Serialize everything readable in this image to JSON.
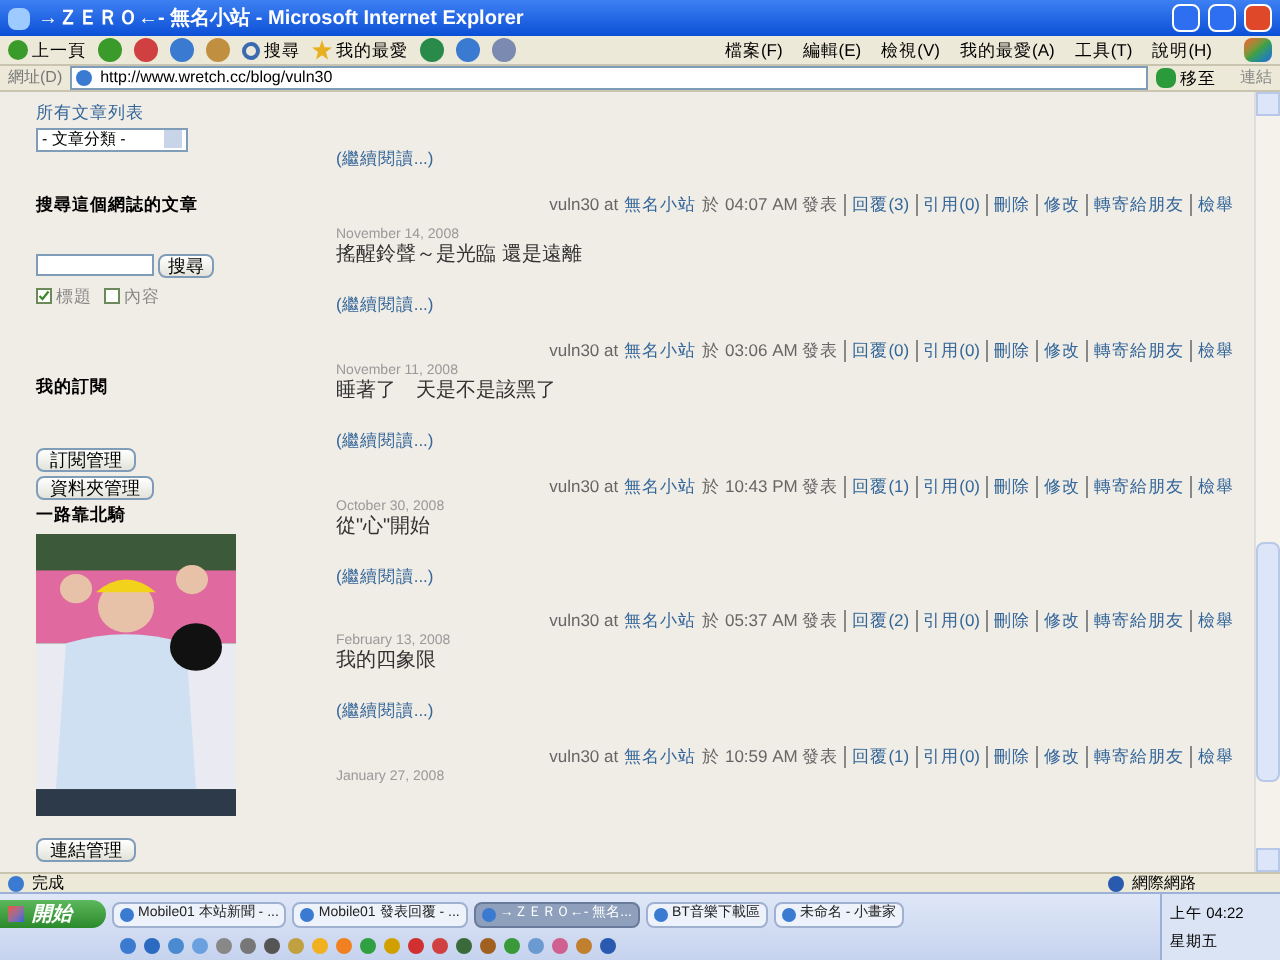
{
  "window": {
    "title": "→ＺＥＲＯ←- 無名小站 - Microsoft Internet Explorer"
  },
  "toolbar": {
    "back": "上一頁",
    "search": "搜尋",
    "favorites": "我的最愛"
  },
  "menu": [
    "檔案(F)",
    "編輯(E)",
    "檢視(V)",
    "我的最愛(A)",
    "工具(T)",
    "說明(H)"
  ],
  "address_bar": {
    "label": "網址(D)",
    "value": "http://www.wretch.cc/blog/vuln30",
    "go": "移至",
    "links": "連結"
  },
  "sidebar": {
    "all_posts_link": "所有文章列表",
    "category_select": "- 文章分類 -",
    "search_heading": "搜尋這個網誌的文章",
    "search_button": "搜尋",
    "options": [
      {
        "label": "標題",
        "checked": true
      },
      {
        "label": "內容",
        "checked": false
      }
    ],
    "subscriptions_heading": "我的訂閱",
    "subscription_buttons": [
      "訂閱管理",
      "資料夾管理"
    ],
    "banner_title": "一路靠北騎",
    "links_button": "連結管理"
  },
  "posts": [
    {
      "read_more": "(繼續閱讀...)",
      "footer": {
        "by": "vuln30 at",
        "site": "無名小站",
        "posted": "於 04:07 AM 發表",
        "links": [
          "回覆(3)",
          "引用(0)",
          "刪除",
          "修改",
          "轉寄給朋友",
          "檢舉"
        ]
      }
    },
    {
      "date": "November 14, 2008",
      "title": "搖醒鈴聲～是光臨 還是遠離",
      "read_more": "(繼續閱讀...)",
      "footer": {
        "by": "vuln30 at",
        "site": "無名小站",
        "posted": "於 03:06 AM 發表",
        "links": [
          "回覆(0)",
          "引用(0)",
          "刪除",
          "修改",
          "轉寄給朋友",
          "檢舉"
        ]
      }
    },
    {
      "date": "November 11, 2008",
      "title": "睡著了　天是不是該黑了",
      "read_more": "(繼續閱讀...)",
      "footer": {
        "by": "vuln30 at",
        "site": "無名小站",
        "posted": "於 10:43 PM 發表",
        "links": [
          "回覆(1)",
          "引用(0)",
          "刪除",
          "修改",
          "轉寄給朋友",
          "檢舉"
        ]
      }
    },
    {
      "date": "October 30, 2008",
      "title": "從\"心\"開始",
      "read_more": "(繼續閱讀...)",
      "footer": {
        "by": "vuln30 at",
        "site": "無名小站",
        "posted": "於 05:37 AM 發表",
        "links": [
          "回覆(2)",
          "引用(0)",
          "刪除",
          "修改",
          "轉寄給朋友",
          "檢舉"
        ]
      }
    },
    {
      "date": "February 13, 2008",
      "title": "我的四象限",
      "read_more": "(繼續閱讀...)",
      "footer": {
        "by": "vuln30 at",
        "site": "無名小站",
        "posted": "於 10:59 AM 發表",
        "links": [
          "回覆(1)",
          "引用(0)",
          "刪除",
          "修改",
          "轉寄給朋友",
          "檢舉"
        ]
      }
    },
    {
      "date": "January 27, 2008"
    }
  ],
  "status_bar": {
    "text": "完成",
    "zone": "網際網路"
  },
  "taskbar": {
    "start": "開始",
    "tasks": [
      {
        "label": "Mobile01 本站新聞 - ...",
        "selected": false
      },
      {
        "label": "Mobile01 發表回覆 - ...",
        "selected": false
      },
      {
        "label": "→ＺＥＲＯ←- 無名...",
        "selected": true
      },
      {
        "label": "BT音樂下載區",
        "selected": false
      },
      {
        "label": "未命名 - 小畫家",
        "selected": false
      }
    ],
    "time": "上午 04:22",
    "day": "星期五"
  }
}
